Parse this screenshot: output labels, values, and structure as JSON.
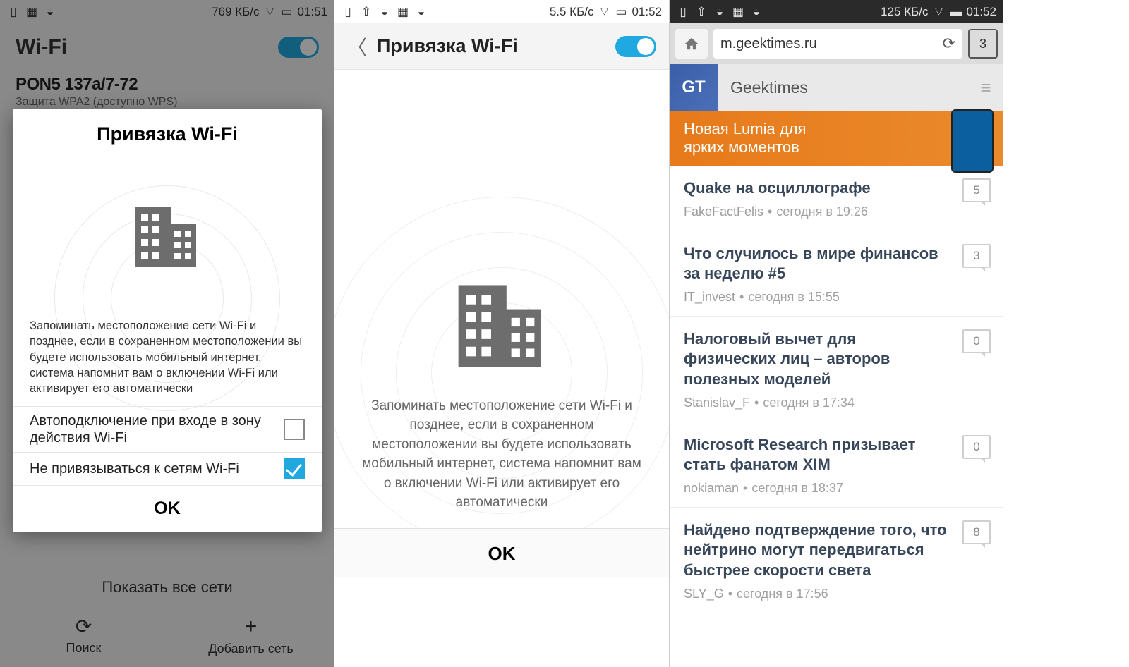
{
  "screen1": {
    "status": {
      "speed": "769 КБ/с",
      "time": "01:51"
    },
    "header_title": "Wi-Fi",
    "network": {
      "ssid": "PON5 137a/7-72",
      "security": "Защита WPA2 (доступно WPS)"
    },
    "dialog": {
      "title": "Привязка Wi-Fi",
      "description": "Запоминать местоположение сети Wi-Fi и позднее, если в сохраненном местоположении вы будете использовать мобильный интернет, система напомнит вам о включении Wi-Fi или активирует его автоматически",
      "opt_autoconnect": "Автоподключение при входе в зону действия Wi-Fi",
      "opt_dontbind": "Не привязываться к сетям Wi-Fi",
      "ok": "OK"
    },
    "footer": {
      "search": "Поиск",
      "add": "Добавить сеть"
    },
    "show_all": "Показать все сети"
  },
  "screen2": {
    "status": {
      "speed": "5.5 КБ/с",
      "time": "01:52"
    },
    "title": "Привязка Wi-Fi",
    "description": "Запоминать местоположение сети Wi-Fi и позднее, если в сохраненном местоположении вы будете использовать мобильный интернет, система напомнит вам о включении Wi-Fi или активирует его автоматически",
    "ok": "OK"
  },
  "screen3": {
    "status": {
      "speed": "125 КБ/с",
      "time": "01:52"
    },
    "url": "m.geektimes.ru",
    "tab_count": "3",
    "logo_text": "GT",
    "site_title": "Geektimes",
    "banner_line1": "Новая Lumia для",
    "banner_line2": "ярких моментов",
    "items": [
      {
        "title": "Quake на осциллографе",
        "author": "FakeFactFelis",
        "time": "сегодня в 19:26",
        "count": "5"
      },
      {
        "title": "Что случилось в мире финансов за неделю #5",
        "author": "IT_invest",
        "time": "сегодня в 15:55",
        "count": "3"
      },
      {
        "title": "Налоговый вычет для физических лиц – авторов полезных моделей",
        "author": "Stanislav_F",
        "time": "сегодня в 17:34",
        "count": "0"
      },
      {
        "title": "Microsoft Research призывает стать фанатом XIM",
        "author": "nokiaman",
        "time": "сегодня в 18:37",
        "count": "0"
      },
      {
        "title": "Найдено подтверждение того, что нейтрино могут передвигаться быстрее скорости света",
        "author": "SLY_G",
        "time": "сегодня в 17:56",
        "count": "8"
      }
    ]
  }
}
